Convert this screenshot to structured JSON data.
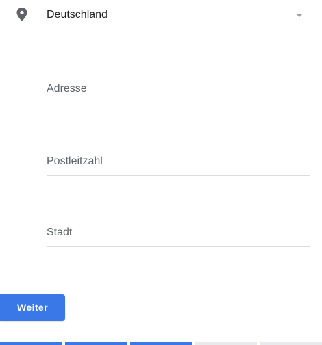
{
  "form": {
    "country": {
      "value": "Deutschland",
      "icon": "location-pin-icon",
      "caret_icon": "dropdown-caret-icon"
    },
    "address": {
      "placeholder": "Adresse"
    },
    "postal_code": {
      "placeholder": "Postleitzahl"
    },
    "city": {
      "placeholder": "Stadt"
    },
    "submit_label": "Weiter"
  },
  "progress": {
    "steps_total": 5,
    "steps_done": 3
  },
  "colors": {
    "accent": "#3b78e7",
    "icon": "#5f6368",
    "placeholder": "#5f6368",
    "underline": "#dcdcdc",
    "progress_todo": "#e8eaed"
  }
}
